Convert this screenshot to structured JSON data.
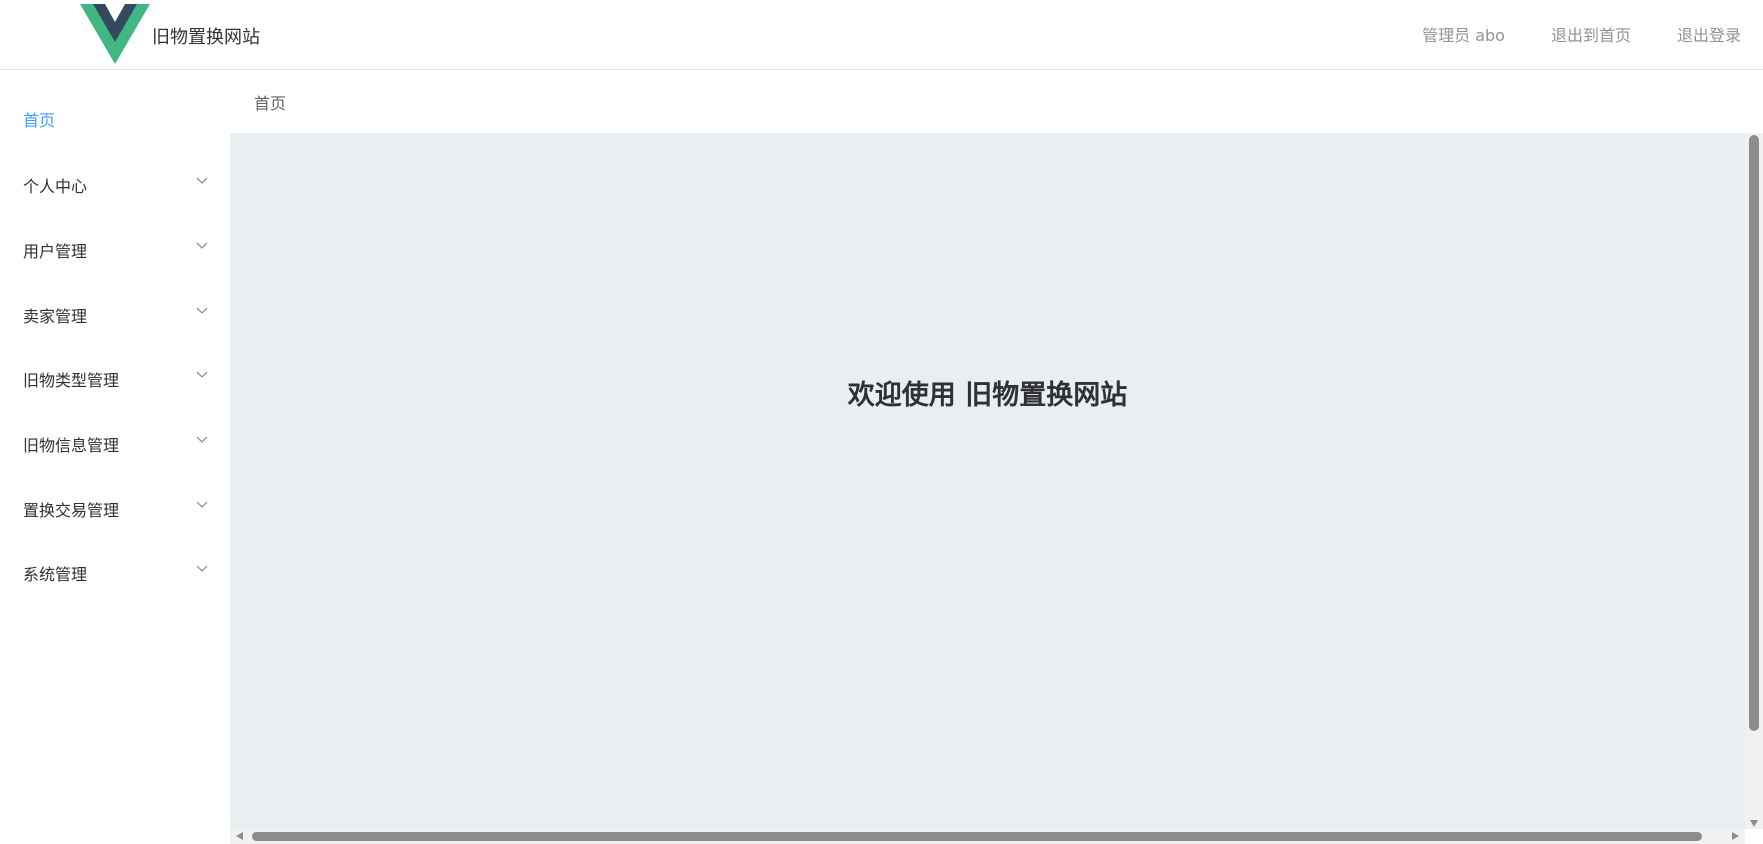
{
  "header": {
    "site_title": "旧物置换网站",
    "admin_label": "管理员 abo",
    "exit_home": "退出到首页",
    "logout": "退出登录",
    "logo_colors": {
      "outer": "#41b883",
      "inner": "#35495e"
    }
  },
  "sidebar": {
    "items": [
      {
        "label": "首页",
        "active": true,
        "icon": "none"
      },
      {
        "label": "个人中心",
        "icon": "chevron-down-icon"
      },
      {
        "label": "用户管理",
        "icon": "chevron-down-icon"
      },
      {
        "label": "卖家管理",
        "icon": "chevron-down-icon"
      },
      {
        "label": "旧物类型管理",
        "icon": "chevron-down-icon"
      },
      {
        "label": "旧物信息管理",
        "icon": "chevron-down-icon"
      },
      {
        "label": "置换交易管理",
        "icon": "chevron-down-icon"
      },
      {
        "label": "系统管理",
        "icon": "chevron-down-icon"
      }
    ]
  },
  "breadcrumb": {
    "current": "首页"
  },
  "main": {
    "welcome_text": "欢迎使用 旧物置换网站"
  },
  "colors": {
    "accent": "#409eff",
    "content_bg": "#e9eef3",
    "scrollbar_thumb": "#8c8c8c"
  }
}
